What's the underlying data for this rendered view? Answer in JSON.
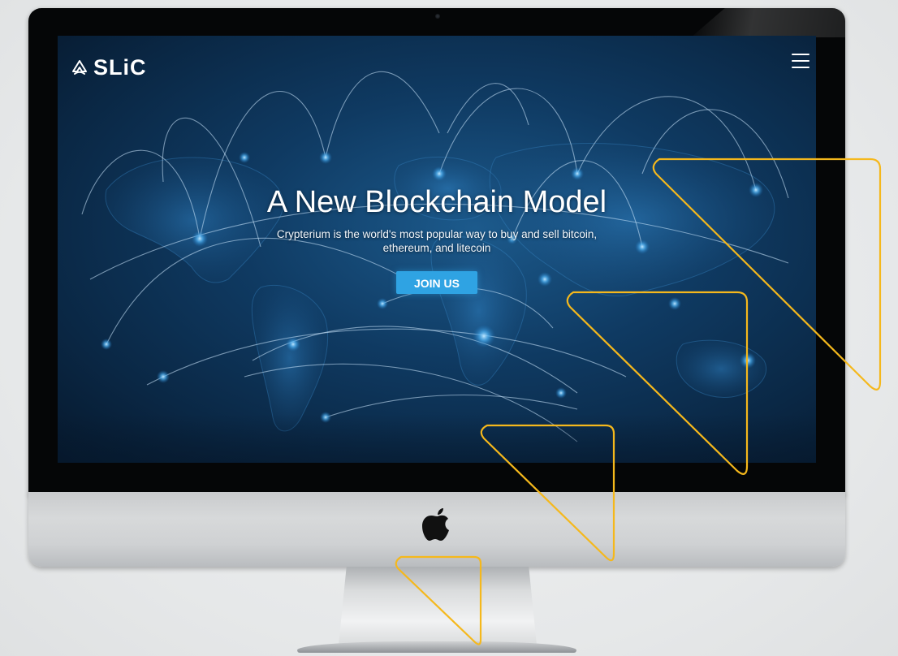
{
  "site": {
    "logo_text": "SLiC",
    "menu_icon": "hamburger-menu-icon"
  },
  "hero": {
    "title": "A New Blockchain Model",
    "subtitle": "Crypterium is the world's most popular way to buy and sell bitcoin, ethereum, and litecoin",
    "cta_label": "JOIN US"
  },
  "device": {
    "type": "desktop-monitor",
    "logo_icon": "apple-logo-icon"
  },
  "colors": {
    "accent": "#2fa3e3",
    "decoration_outline": "#f5b81c",
    "screen_background": "#0f3a62",
    "text": "#ffffff"
  }
}
